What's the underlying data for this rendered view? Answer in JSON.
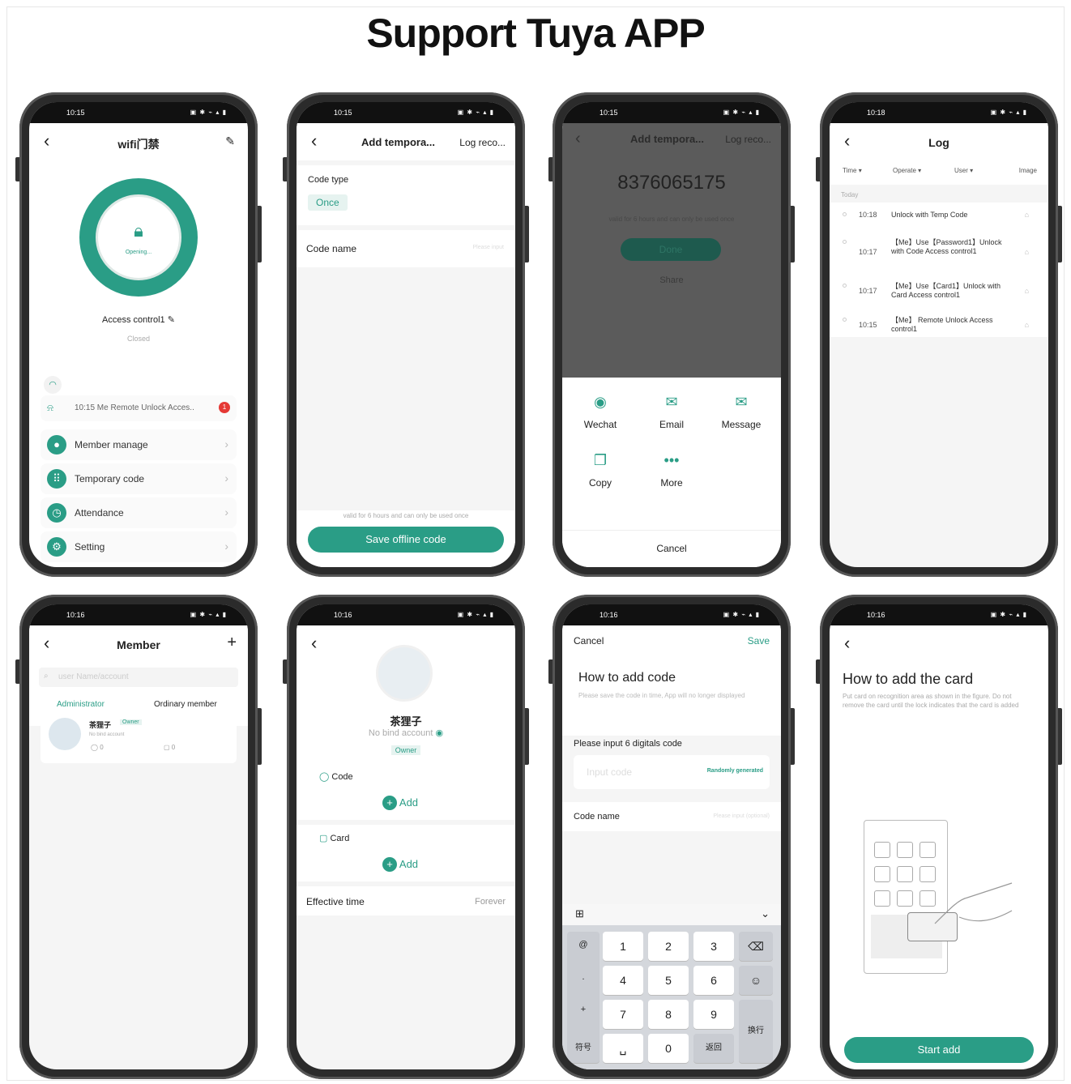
{
  "page_title": "Support Tuya APP",
  "colors": {
    "accent": "#2a9d86",
    "alert": "#e53935"
  },
  "phone1": {
    "time": "10:15",
    "title": "wifi门禁",
    "ring_status": "Opening...",
    "device_name": "Access control1",
    "device_state": "Closed",
    "notification": "10:15 Me  Remote Unlock Acces..",
    "badge": "1",
    "menu": [
      {
        "label": "Member manage",
        "icon": "person-icon"
      },
      {
        "label": "Temporary code",
        "icon": "grid-icon"
      },
      {
        "label": "Attendance",
        "icon": "clock-icon"
      },
      {
        "label": "Setting",
        "icon": "gear-icon"
      }
    ]
  },
  "phone2": {
    "time": "10:15",
    "title": "Add tempora...",
    "log_link": "Log reco...",
    "code_type_label": "Code type",
    "code_type_value": "Once",
    "code_name_label": "Code name",
    "code_name_placeholder": "Please input",
    "note": "valid for 6 hours and can only be used once",
    "save_button": "Save offline code"
  },
  "phone3": {
    "time": "10:15",
    "title": "Add tempora...",
    "log_link": "Log reco...",
    "code": "8376065175",
    "note": "valid for 6 hours and can only be used once",
    "done": "Done",
    "share": "Share",
    "share_options": [
      {
        "label": "Wechat",
        "icon": "wechat-icon"
      },
      {
        "label": "Email",
        "icon": "email-icon"
      },
      {
        "label": "Message",
        "icon": "message-icon"
      },
      {
        "label": "Copy",
        "icon": "copy-icon"
      },
      {
        "label": "More",
        "icon": "more-icon"
      }
    ],
    "cancel": "Cancel"
  },
  "phone4": {
    "time": "10:18",
    "title": "Log",
    "filters": [
      "Time",
      "Operate",
      "User",
      "Image"
    ],
    "section": "Today",
    "entries": [
      {
        "time": "10:18",
        "event": "Unlock with Temp Code"
      },
      {
        "time": "10:17",
        "event": "【Me】Use【Password1】Unlock with Code Access control1"
      },
      {
        "time": "10:17",
        "event": "【Me】Use【Card1】Unlock with Card Access control1"
      },
      {
        "time": "10:15",
        "event": "【Me】 Remote Unlock Access control1"
      }
    ]
  },
  "phone5": {
    "time": "10:16",
    "title": "Member",
    "add": "+",
    "search_placeholder": "user Name/account",
    "tabs": [
      "Administrator",
      "Ordinary member"
    ],
    "member_name": "茶狸子",
    "member_role": "Owner",
    "member_sub": "No bind account",
    "code_count": "0",
    "card_count": "0"
  },
  "phone6": {
    "time": "10:16",
    "name": "茶狸子",
    "account": "No bind account",
    "role": "Owner",
    "code_label": "Code",
    "card_label": "Card",
    "add_label": "Add",
    "effective_label": "Effective time",
    "effective_value": "Forever"
  },
  "phone7": {
    "time": "10:16",
    "cancel": "Cancel",
    "save": "Save",
    "heading": "How to add code",
    "desc": "Please save the code in time, App will no longer displayed",
    "input_label": "Please input 6 digitals code",
    "input_placeholder": "Input code",
    "random": "Randomly generated",
    "code_name_label": "Code name",
    "code_name_placeholder": "Please input (optional)",
    "keys": [
      "1",
      "2",
      "3",
      "4",
      "5",
      "6",
      "7",
      "8",
      "9",
      "0"
    ],
    "key_fuhao": "符号",
    "key_fanhui": "返回",
    "key_huanhang": "换行"
  },
  "phone8": {
    "time": "10:16",
    "heading": "How to add the card",
    "desc": "Put card on recognition area as shown in the figure. Do not remove the card until the lock indicates that the card is added",
    "start_button": "Start add"
  }
}
